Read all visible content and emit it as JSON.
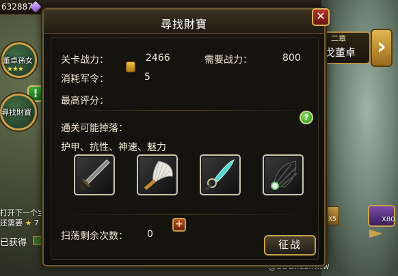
{
  "top_bar": {
    "silver_count": "632887"
  },
  "map": {
    "node_dong": {
      "label": "董卓孫女",
      "stars": "★★★"
    },
    "node_xun": {
      "label": "尋找財寶"
    },
    "side_text_1": "打开下一个宝",
    "side_text_2_prefix": "还需要",
    "side_text_2_suffix": "7",
    "side_got": "已获得",
    "chapter": {
      "small": "二章",
      "name": "戈董卓"
    },
    "rewards": {
      "x80": "X80",
      "x5": "X5"
    },
    "watermark": "@SOGI.com.tw"
  },
  "dialog": {
    "title": "尋找財寶",
    "close_label": "✕",
    "stage_power_label": "关卡战力：",
    "stage_power_value": "2466",
    "required_power_label": "需要战力：",
    "required_power_value": "800",
    "cost_label": "消耗军令：",
    "cost_value": "5",
    "best_score_label": "最高评分：",
    "drops_label": "通关可能掉落：",
    "drops_types": "护甲、抗性、神速、魅力",
    "help_label": "?",
    "sweep_label": "扫荡剩余次数：",
    "sweep_value": "0",
    "plus_label": "+",
    "fight_label": "征战"
  },
  "drop_items": [
    {
      "icon": "sword-icon"
    },
    {
      "icon": "feather-fan-icon"
    },
    {
      "icon": "curved-blade-icon"
    },
    {
      "icon": "feather-armor-icon"
    }
  ]
}
